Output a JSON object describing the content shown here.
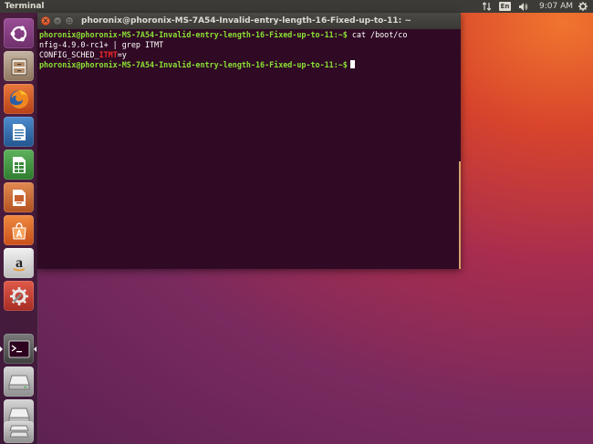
{
  "panel": {
    "app_title": "Terminal",
    "keyboard_layout": "En",
    "clock": "9:07 AM",
    "icons": [
      "sort-updown-icon",
      "network-icon",
      "keyboard-indicator",
      "volume-icon",
      "clock",
      "gear-icon"
    ]
  },
  "launcher": {
    "items": [
      {
        "name": "launcher-dash",
        "icon": "ubuntu-logo-icon",
        "color": "#7b3d7a"
      },
      {
        "name": "launcher-files",
        "icon": "file-cabinet-icon",
        "color": "#8b6c55"
      },
      {
        "name": "launcher-firefox",
        "icon": "firefox-icon",
        "color": "#d35422"
      },
      {
        "name": "launcher-writer",
        "icon": "writer-icon",
        "color": "#2e6ea8"
      },
      {
        "name": "launcher-calc",
        "icon": "calc-icon",
        "color": "#3c8a3c"
      },
      {
        "name": "launcher-impress",
        "icon": "impress-icon",
        "color": "#c8612d"
      },
      {
        "name": "launcher-software",
        "icon": "software-center-icon",
        "color": "#e0631f"
      },
      {
        "name": "launcher-amazon",
        "icon": "amazon-icon",
        "color": "#d8d8d8"
      },
      {
        "name": "launcher-settings",
        "icon": "system-settings-icon",
        "color": "#c9453a"
      },
      {
        "name": "launcher-terminal",
        "icon": "terminal-icon",
        "color": "#4a4a4a"
      },
      {
        "name": "launcher-drive",
        "icon": "drive-icon",
        "color": "#9a9a9a"
      },
      {
        "name": "launcher-drive-2",
        "icon": "drive-icon",
        "color": "#9a9a9a"
      },
      {
        "name": "launcher-trash",
        "icon": "trash-icon",
        "color": "#9a9a9a"
      }
    ]
  },
  "window": {
    "title": "phoronix@phoronix-MS-7A54-Invalid-entry-length-16-Fixed-up-to-11: ~",
    "close_glyph": "×",
    "minimize_glyph": "–",
    "maximize_glyph": "▫"
  },
  "terminal": {
    "line1_prompt": "phoronix@phoronix-MS-7A54-Invalid-entry-length-16-Fixed-up-to-11:~$",
    "line1_cmd": " cat /boot/co",
    "line2_text": "nfig-4.9.0-rc1+ | grep ITMT",
    "line3_prefix": "CONFIG_SCHED_",
    "line3_match": "ITMT",
    "line3_suffix": "=y",
    "line4_prompt": "phoronix@phoronix-MS-7A54-Invalid-entry-length-16-Fixed-up-to-11:~$",
    "colors": {
      "background": "#300a24",
      "prompt": "#8ae234",
      "match": "#ef2929",
      "text": "#ffffff"
    }
  }
}
